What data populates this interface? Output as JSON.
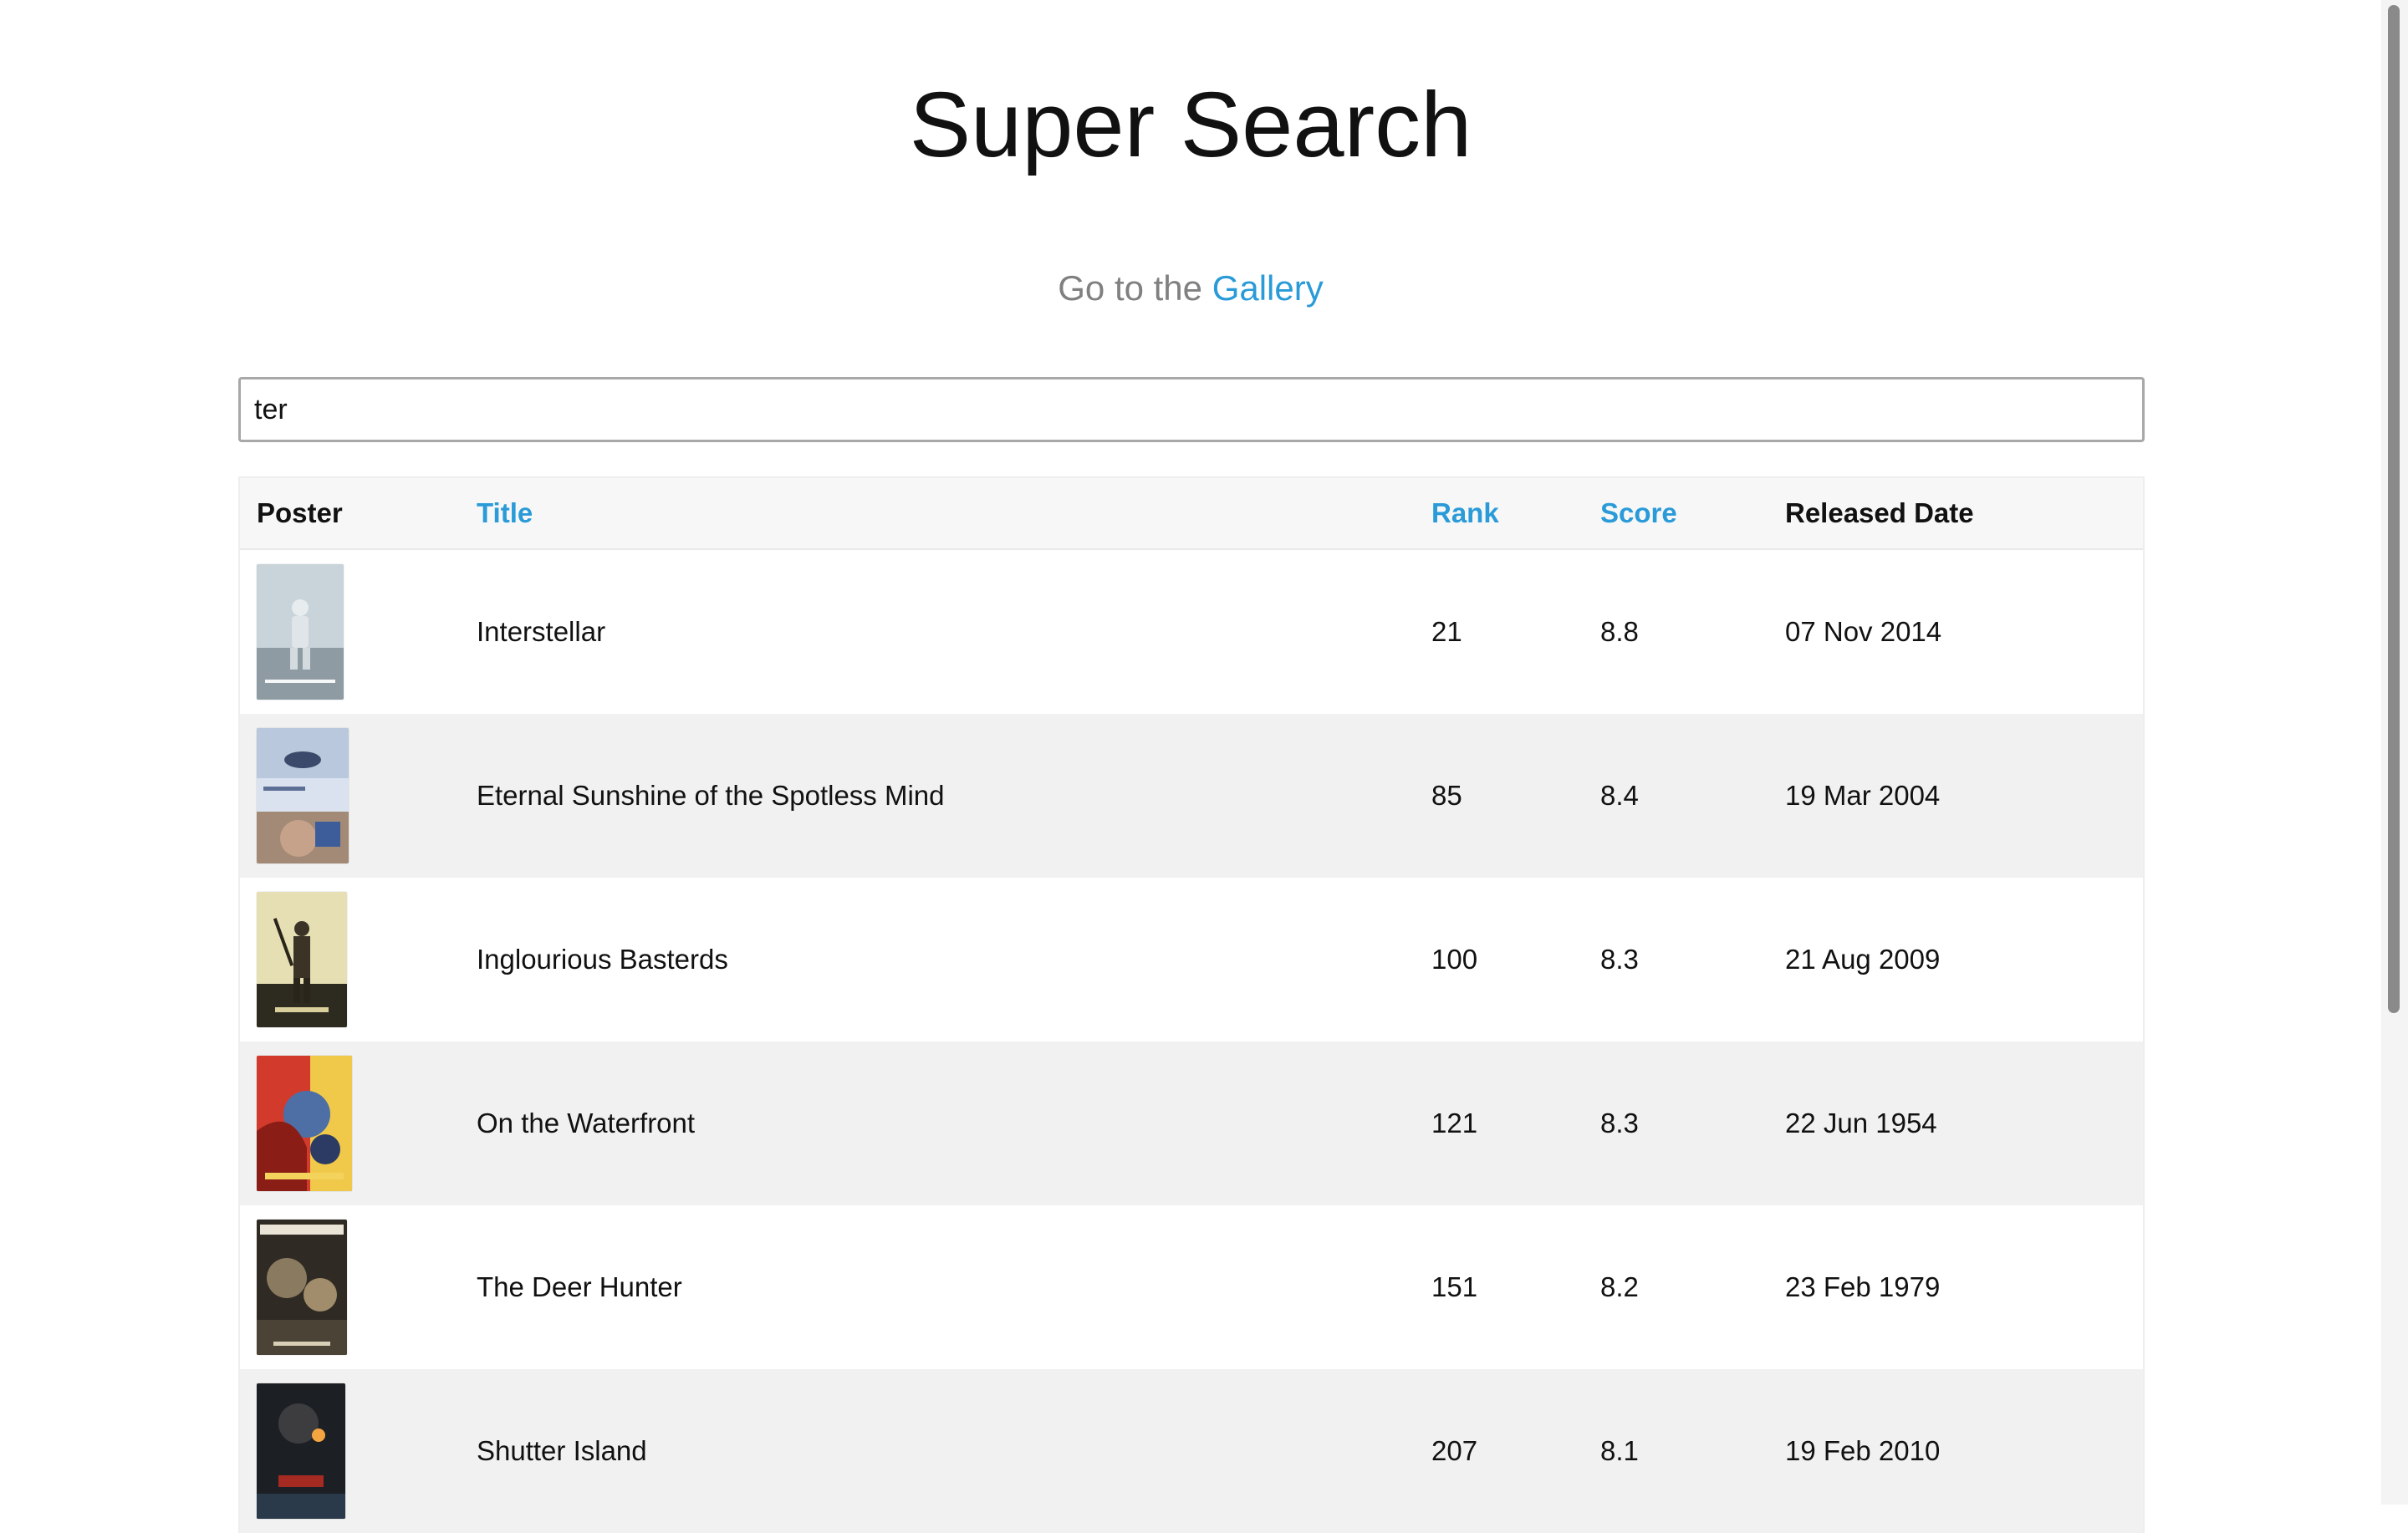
{
  "page": {
    "title": "Super Search",
    "subtitle_prefix": "Go to the ",
    "subtitle_link": "Gallery"
  },
  "search": {
    "value": "ter"
  },
  "table": {
    "headers": {
      "poster": "Poster",
      "title": "Title",
      "rank": "Rank",
      "score": "Score",
      "released": "Released Date"
    },
    "rows": [
      {
        "title": "Interstellar",
        "rank": "21",
        "score": "8.8",
        "released": "07 Nov 2014",
        "poster_icon": "astronaut-poster"
      },
      {
        "title": "Eternal Sunshine of the Spotless Mind",
        "rank": "85",
        "score": "8.4",
        "released": "19 Mar 2004",
        "poster_icon": "couple-in-snow-poster"
      },
      {
        "title": "Inglourious Basterds",
        "rank": "100",
        "score": "8.3",
        "released": "21 Aug 2009",
        "poster_icon": "soldier-poster"
      },
      {
        "title": "On the Waterfront",
        "rank": "121",
        "score": "8.3",
        "released": "22 Jun 1954",
        "poster_icon": "portrait-poster"
      },
      {
        "title": "The Deer Hunter",
        "rank": "151",
        "score": "8.2",
        "released": "23 Feb 1979",
        "poster_icon": "war-poster"
      },
      {
        "title": "Shutter Island",
        "rank": "207",
        "score": "8.1",
        "released": "19 Feb 2010",
        "poster_icon": "lighthouse-poster"
      }
    ]
  },
  "colors": {
    "link": "#2a9bd8",
    "muted_text": "#808080",
    "header_bg": "#f7f7f7",
    "alt_row_bg": "#f1f1f1"
  }
}
